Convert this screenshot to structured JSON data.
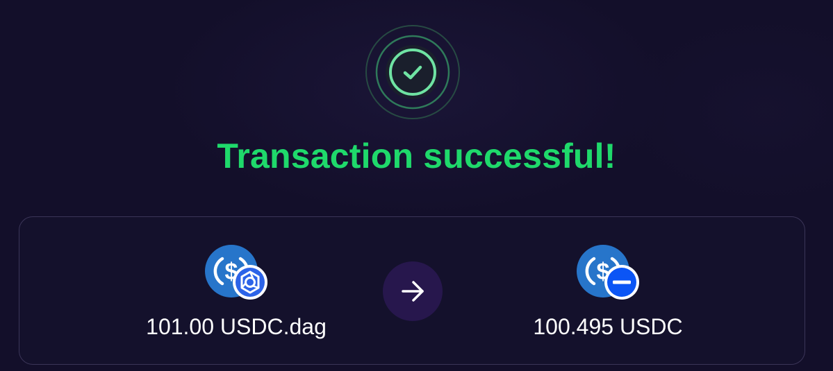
{
  "status": {
    "title": "Transaction successful!",
    "icon": "check-circle-icon",
    "color": "#1fd96b"
  },
  "swap": {
    "from": {
      "amount_label": "101.00 USDC.dag",
      "token_icon": "usdc-icon",
      "network_icon": "constellation-dag-icon"
    },
    "to": {
      "amount_label": "100.495 USDC",
      "token_icon": "usdc-icon",
      "network_icon": "ethereum-network-icon"
    },
    "direction_icon": "arrow-right-icon"
  },
  "colors": {
    "background": "#130f2a",
    "success": "#1fd96b",
    "usdc_blue": "#2775ca",
    "arrow_bg": "#27174d"
  }
}
